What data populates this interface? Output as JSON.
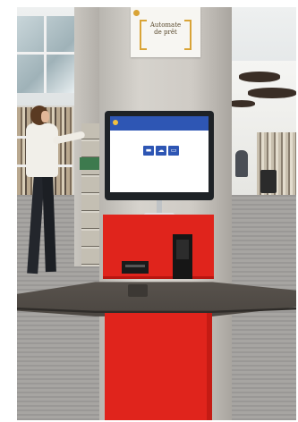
{
  "sign": {
    "small_text": "",
    "title": "Automate de prêt"
  },
  "screen": {
    "header": "",
    "header_right": "",
    "title": "",
    "footer": "",
    "icons": [
      "book-icon",
      "cloud-icon",
      "card-icon"
    ]
  },
  "colors": {
    "kiosk_red": "#e0241c",
    "screen_blue": "#2e56b4",
    "sign_accent": "#d9a437"
  }
}
